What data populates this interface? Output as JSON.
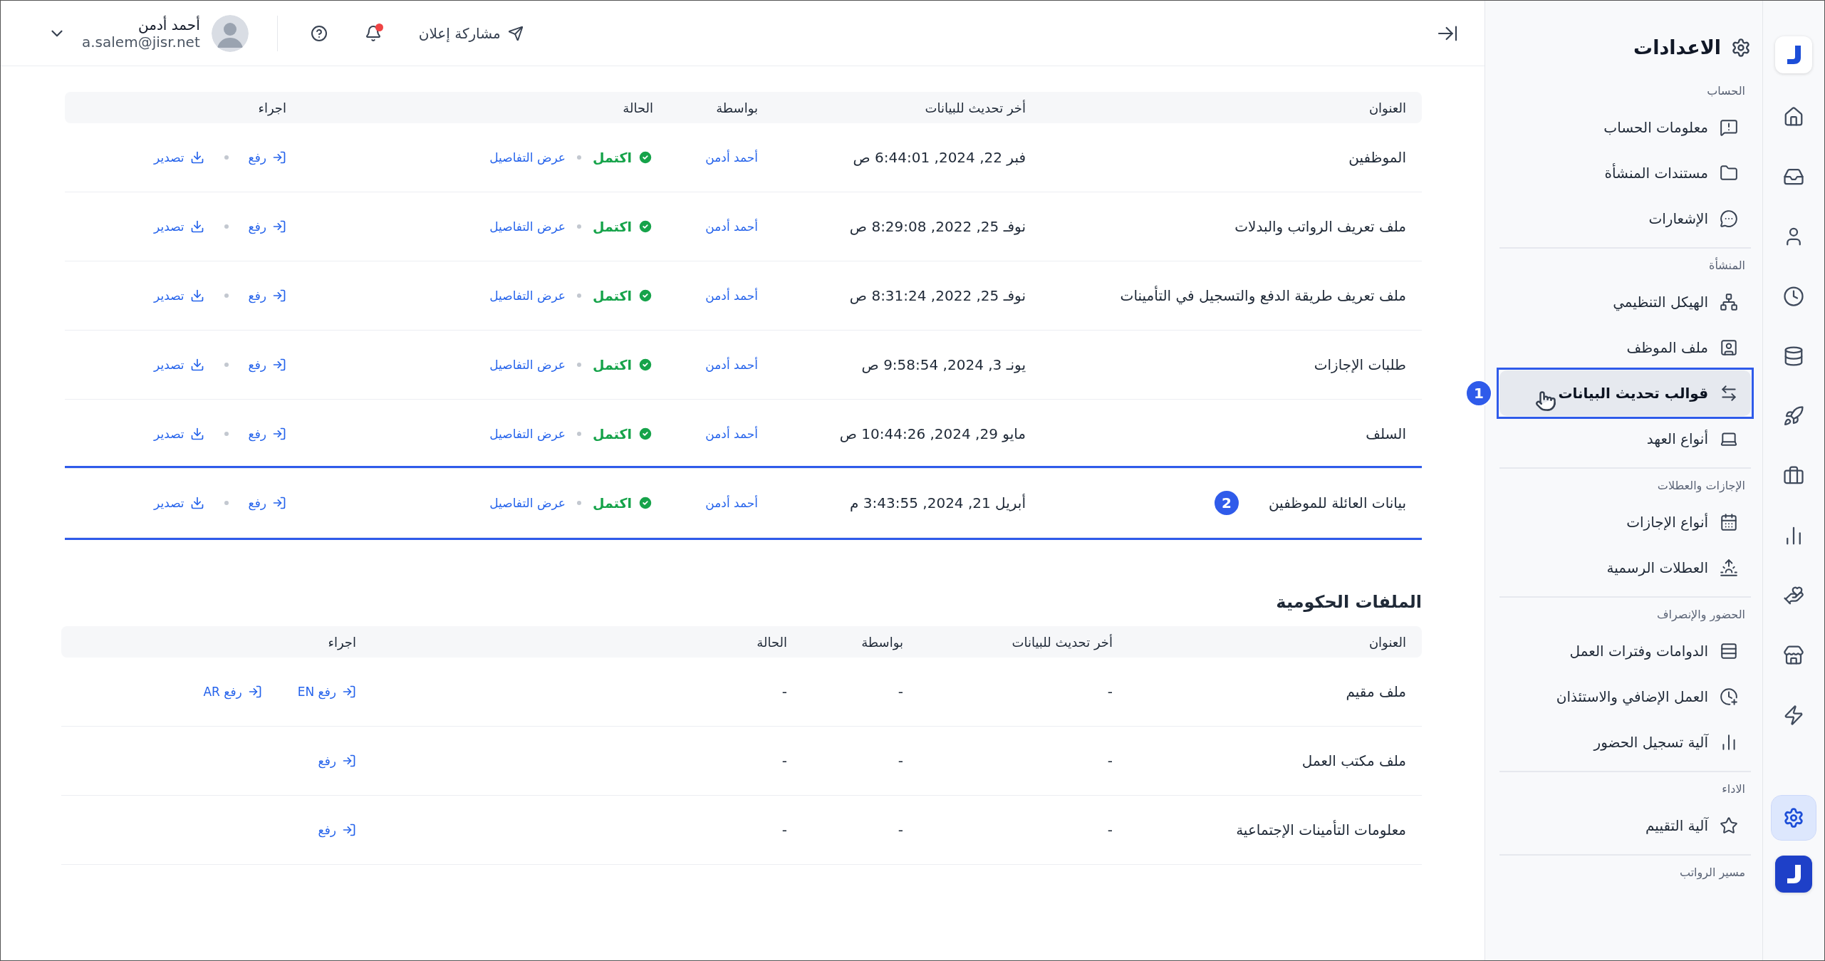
{
  "rail": {
    "items": [
      {
        "selected": false
      },
      {
        "selected": false
      },
      {
        "selected": false
      },
      {
        "selected": false
      },
      {
        "selected": false
      },
      {
        "selected": false
      },
      {
        "selected": false
      },
      {
        "selected": false
      },
      {
        "selected": false
      },
      {
        "selected": false
      },
      {
        "selected": false
      },
      {
        "selected": true
      }
    ]
  },
  "sidebar": {
    "title": "الاعدادات",
    "sections": [
      {
        "title": "الحساب",
        "items": [
          {
            "label": "معلومات الحساب",
            "selected": false
          },
          {
            "label": "مستندات المنشأة",
            "selected": false
          },
          {
            "label": "الإشعارات",
            "selected": false
          }
        ]
      },
      {
        "title": "المنشأة",
        "items": [
          {
            "label": "الهيكل التنظيمي",
            "selected": false
          },
          {
            "label": "ملف الموظف",
            "selected": false
          },
          {
            "label": "قوالب تحديث البيانات",
            "selected": true,
            "callout": "1"
          },
          {
            "label": "أنواع العهد",
            "selected": false
          }
        ]
      },
      {
        "title": "الإجازات والعطلات",
        "items": [
          {
            "label": "أنواع الإجازات",
            "selected": false
          },
          {
            "label": "العطلات الرسمية",
            "selected": false
          }
        ]
      },
      {
        "title": "الحضور والإنصراف",
        "items": [
          {
            "label": "الدوامات وفترات العمل",
            "selected": false
          },
          {
            "label": "العمل الإضافي والاستئذان",
            "selected": false
          },
          {
            "label": "آلية تسجيل الحضور",
            "selected": false
          }
        ]
      },
      {
        "title": "الاداء",
        "items": [
          {
            "label": "آلية التقييم",
            "selected": false
          }
        ]
      },
      {
        "title": "مسير الرواتب"
      }
    ]
  },
  "header": {
    "share": "مشاركة إعلان",
    "has_notification": true,
    "user": {
      "name": "أحمد أدمن",
      "email": "a.salem@jisr.net"
    }
  },
  "templates_table": {
    "columns": [
      "العنوان",
      "أخر تحديث للبيانات",
      "بواسطة",
      "الحالة",
      "اجراء"
    ],
    "rows": [
      {
        "title": "الموظفين",
        "updated": "فبر 22, 2024, 6:44:01 ص",
        "by": "أحمد أدمن",
        "status": {
          "label": "اكتمل",
          "kind": "complete"
        },
        "details": "عرض التفاصيل",
        "actions": [
          "رفع",
          "تصدير"
        ]
      },
      {
        "title": "ملف تعريف الرواتب والبدلات",
        "updated": "نوفـ 25, 2022, 8:29:08 ص",
        "by": "أحمد أدمن",
        "status": {
          "label": "اكتمل",
          "kind": "complete"
        },
        "details": "عرض التفاصيل",
        "actions": [
          "رفع",
          "تصدير"
        ]
      },
      {
        "title": "ملف تعريف طريقة الدفع والتسجيل في التأمينات",
        "updated": "نوفـ 25, 2022, 8:31:24 ص",
        "by": "أحمد أدمن",
        "status": {
          "label": "اكتمل",
          "kind": "complete"
        },
        "details": "عرض التفاصيل",
        "actions": [
          "رفع",
          "تصدير"
        ]
      },
      {
        "title": "طلبات الإجازات",
        "updated": "يونـ 3, 2024, 9:58:54 ص",
        "by": "أحمد أدمن",
        "status": {
          "label": "اكتمل",
          "kind": "complete"
        },
        "details": "عرض التفاصيل",
        "actions": [
          "رفع",
          "تصدير"
        ]
      },
      {
        "title": "السلف",
        "updated": "مايو 29, 2024, 10:44:26 ص",
        "by": "أحمد أدمن",
        "status": {
          "label": "اكتمل",
          "kind": "complete"
        },
        "details": "عرض التفاصيل",
        "actions": [
          "رفع",
          "تصدير"
        ]
      },
      {
        "title": "بيانات العائلة للموظفين",
        "updated": "أبريل 21, 2024, 3:43:55 م",
        "by": "أحمد أدمن",
        "status": {
          "label": "اكتمل",
          "kind": "complete"
        },
        "details": "عرض التفاصيل",
        "actions": [
          "رفع",
          "تصدير"
        ],
        "callout": "2"
      }
    ]
  },
  "government_files": {
    "title": "الملفات الحكومية",
    "columns": [
      "العنوان",
      "أخر تحديث للبيانات",
      "بواسطة",
      "الحالة",
      "اجراء"
    ],
    "rows": [
      {
        "title": "ملف مقيم",
        "updated": "-",
        "by": "-",
        "status": "-",
        "actions": [
          "رفع EN",
          "رفع AR"
        ]
      },
      {
        "title": "ملف مكتب العمل",
        "updated": "-",
        "by": "-",
        "status": "-",
        "actions": [
          "رفع"
        ]
      },
      {
        "title": "معلومات التأمينات الإجتماعية",
        "updated": "-",
        "by": "-",
        "status": "-",
        "actions": [
          "رفع"
        ]
      }
    ]
  }
}
